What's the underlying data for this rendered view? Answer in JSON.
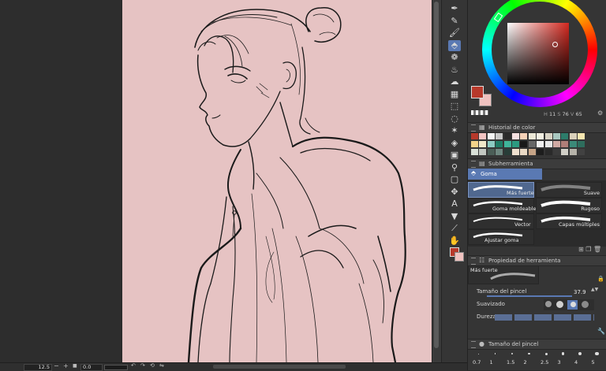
{
  "colors": {
    "canvas": "#e6c3c3",
    "main_color": "#b7392b",
    "sub_color": "#f0c2c0",
    "accent": "#5a79b3",
    "hsv_box_hue": "#d4281f"
  },
  "toolbar": {
    "tools": [
      "pen-icon",
      "pencil-icon",
      "brush-icon",
      "eraser-icon",
      "decoration-icon",
      "airbrush-icon",
      "blend-icon",
      "figure-icon",
      "operation-icon",
      "lasso-icon",
      "magic-wand-icon",
      "fill-icon",
      "gradient-icon",
      "eyedropper-icon",
      "rectangle-select-icon",
      "move-layer-icon",
      "text-icon",
      "balloon-icon",
      "correct-line-icon",
      "hand-icon",
      "eyedropper-2-icon"
    ],
    "active_tool": "eraser-icon"
  },
  "color_wheel": {
    "values": [
      "11",
      "76",
      "65"
    ],
    "hue_marker_deg": 3,
    "box_marker": {
      "s": 0.76,
      "v": 0.65
    }
  },
  "color_history": {
    "title": "Historial de color",
    "swatches": [
      "#b7392b",
      "#f2c4c2",
      "#f5f5f5",
      "#c9c9c9",
      "#2a2a2a",
      "#f6e0e0",
      "#f6d2b7",
      "#ece8d6",
      "#f2efe2",
      "#d8d3c5",
      "#a9c8c0",
      "#2d7c6a",
      "#d9d0ba",
      "#f6e6b0",
      "#f2d38a",
      "#efe7c9",
      "#8ccac2",
      "#1f7a64",
      "#3fb49a",
      "#2c9a80",
      "#181818",
      "#666666",
      "#f0f0f0",
      "#e8e8e8",
      "#d0a9a3",
      "#b07e78",
      "#3b8a78",
      "#2e6d5d",
      "#d9e0d7",
      "#c2c7c1",
      "#4b5e57",
      "#6e8780",
      "#283d38",
      "#efe0cf",
      "#e9d9c5",
      "#c6a487",
      "#1d1d1d",
      "#2a2a2a",
      "#3b3b3b",
      "#d1cfc7",
      "#b6b3a9",
      "#414141"
    ]
  },
  "subtool": {
    "title": "Subherramienta",
    "group": "Goma",
    "brushes": [
      {
        "label": "Más fuerte"
      },
      {
        "label": "Suave"
      },
      {
        "label": "Goma moldeable"
      },
      {
        "label": "Rugoso"
      },
      {
        "label": "Vector"
      },
      {
        "label": "Capas múltiples"
      },
      {
        "label": "Ajustar goma"
      }
    ],
    "selected": "Más fuerte"
  },
  "tool_property": {
    "title": "Propiedad de herramienta",
    "preset_name": "Más fuerte",
    "brush_size_label": "Tamaño del pincel",
    "brush_size_value": "37.9",
    "smoothing_label": "Suavizado",
    "hardness_label": "Dureza"
  },
  "brush_size_panel": {
    "title": "Tamaño del pincel",
    "sizes": [
      "0.7",
      "1",
      "1.5",
      "2",
      "2.5",
      "3",
      "4",
      "5"
    ]
  },
  "status_bar": {
    "zoom": "12.5",
    "rotation": "0.0"
  }
}
